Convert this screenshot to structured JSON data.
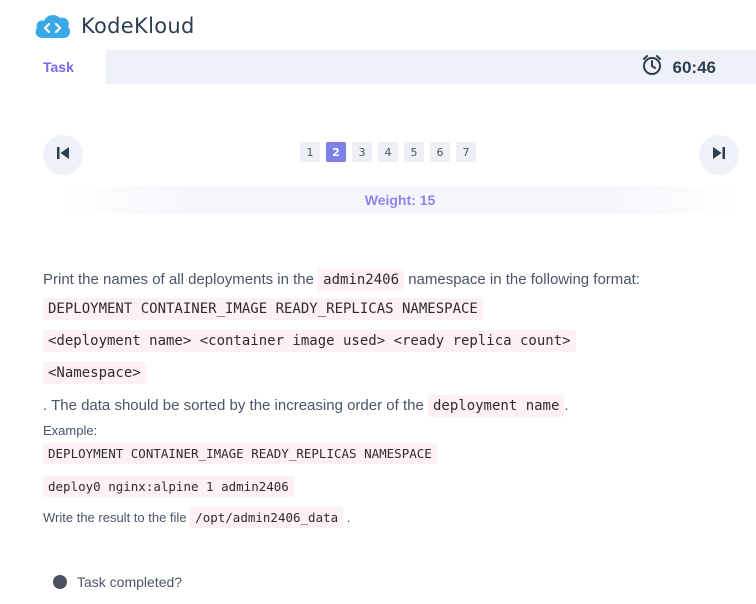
{
  "brand": {
    "name": "KodeKloud",
    "icon": "kodekloud-cloud-logo"
  },
  "header": {
    "task_tab": "Task",
    "timer": "60:46",
    "timer_icon": "alarm-clock-icon"
  },
  "pagination": {
    "pages": [
      "1",
      "2",
      "3",
      "4",
      "5",
      "6",
      "7"
    ],
    "active": "2"
  },
  "weight": "Weight: 15",
  "question": {
    "intro_before": "Print the names of all deployments in the",
    "namespace_code": "admin2406",
    "intro_after": "namespace in the following format:",
    "format_line1": "DEPLOYMENT CONTAINER_IMAGE READY_REPLICAS NAMESPACE",
    "format_line2": "<deployment name> <container image used> <ready replica count>",
    "format_line3": "<Namespace>",
    "sort_before": ". The data should be sorted by the increasing order of the",
    "sort_code": "deployment name",
    "sort_after": ".",
    "example_label": "Example:",
    "example_line1": "DEPLOYMENT CONTAINER_IMAGE READY_REPLICAS NAMESPACE",
    "example_line2": "deploy0 nginx:alpine 1 admin2406",
    "write_before": "Write the result to the file",
    "write_code": "/opt/admin2406_data",
    "write_after": "."
  },
  "footer": {
    "completed_label": "Task completed?"
  },
  "colors": {
    "accent": "#7b68ee",
    "active_page": "#7b83eb",
    "weight": "#8e86f0",
    "code_bg": "#fdf1f7",
    "logo": "#3aa8e6"
  }
}
